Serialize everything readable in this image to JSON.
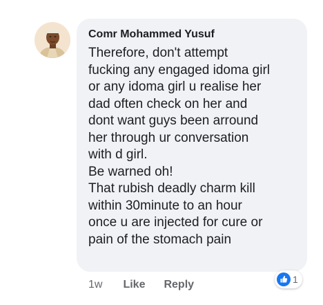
{
  "comment": {
    "author": "Comr Mohammed Yusuf",
    "lines": [
      "Therefore, don't attempt",
      "fucking any engaged idoma girl",
      "or any idoma girl u realise her",
      "dad often check on her and",
      "dont want guys been arround",
      "her through ur conversation",
      "with d girl.",
      "Be warned oh!",
      "That rubish deadly charm kill",
      "within 30minute to an hour",
      "once u are injected for cure or",
      "pain of the stomach pain"
    ],
    "time": "1w",
    "like_label": "Like",
    "reply_label": "Reply",
    "reaction_count": "1",
    "reaction_icon": "thumbs-up-icon"
  },
  "colors": {
    "bubble_bg": "#f0f2f5",
    "text": "#1c1e21",
    "meta": "#65676b",
    "like_blue": "#1877f2"
  }
}
